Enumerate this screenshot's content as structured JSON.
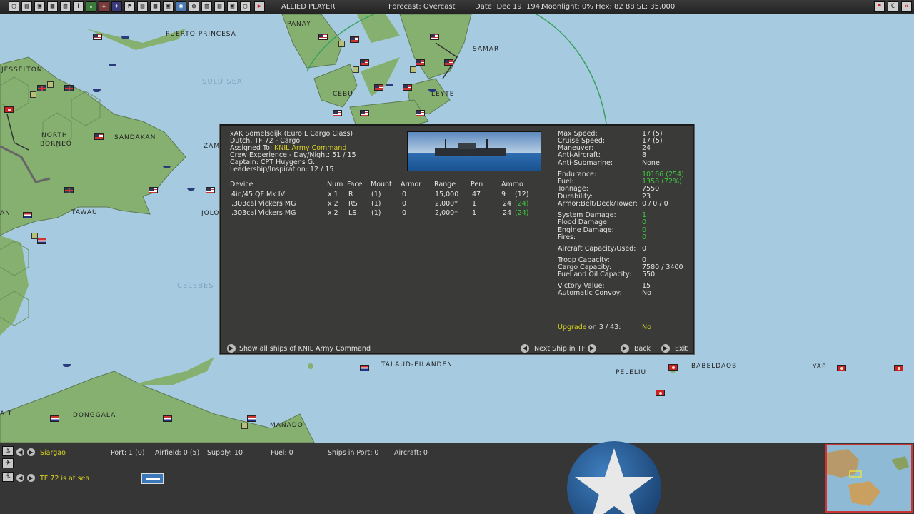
{
  "topbar": {
    "player": "ALLIED PLAYER",
    "forecast": "Forecast: Overcast",
    "date": "Date: Dec 19, 1941",
    "moonlight": "Moonlight: 0%",
    "hex": "Hex: 82 88  SL: 35,000",
    "icon_glyphs": [
      "▢",
      "▤",
      "▣",
      "▦",
      "▥",
      "Ⅰ",
      "★",
      "✚",
      "✈",
      "⚑",
      "▤",
      "▦",
      "▣",
      "◉",
      "◍",
      "▥",
      "▤",
      "▣",
      "▢",
      "▶"
    ],
    "right_icons": [
      "⚑",
      "C",
      "✕"
    ]
  },
  "map": {
    "labels": {
      "panay": "PANAY",
      "puerto_princesa": "PUERTO PRINCESA",
      "samar": "SAMAR",
      "jesselton": "JESSELTON",
      "sulu_sea": "SULU SEA",
      "cebu": "CEBU",
      "leyte": "LEYTE",
      "north_borneo_1": "NORTH",
      "north_borneo_2": "BORNEO",
      "sandakan": "SANDAKAN",
      "zam": "ZAM",
      "jolo": "JOLO",
      "tawau": "TAWAU",
      "an": "AN",
      "celebes": "CELEBES",
      "talaud": "TALAUD-EILANDEN",
      "babeldaob": "BABELDAOB",
      "yap": "YAP",
      "peleliu": "PELELIU",
      "donggala": "DONGGALA",
      "manado": "MANADO",
      "ait": "AIT"
    }
  },
  "dialog": {
    "ship_name": "xAK Somelsdijk (Euro L Cargo Class)",
    "nation_tf": "Dutch, TF 72 - Cargo",
    "assigned_label": "Assigned To:",
    "assigned_value": "KNIL Army Command",
    "crew": "Crew Experience - Day/Night: 51 / 15",
    "captain": "Captain: CPT Huygens G.",
    "leadership": "Leadership/Inspiration: 12 / 15",
    "weapons_headers": [
      "Device",
      "Num",
      "Face",
      "Mount",
      "Armor",
      "Range",
      "Pen",
      "Ammo"
    ],
    "weapons": [
      {
        "device": "4in/45 QF Mk IV",
        "num": "x 1",
        "face": "R",
        "mount": "(1)",
        "armor": "0",
        "range": "15,000",
        "pen": "47",
        "ammo": "9",
        "ammo_max": "(12)",
        "ammo_color": "white"
      },
      {
        "device": ".303cal Vickers MG",
        "num": "x 2",
        "face": "RS",
        "mount": "(1)",
        "armor": "0",
        "range": "2,000*",
        "pen": "1",
        "ammo": "24",
        "ammo_max": "(24)",
        "ammo_color": "green"
      },
      {
        "device": ".303cal Vickers MG",
        "num": "x 2",
        "face": "LS",
        "mount": "(1)",
        "armor": "0",
        "range": "2,000*",
        "pen": "1",
        "ammo": "24",
        "ammo_max": "(24)",
        "ammo_color": "green"
      }
    ],
    "stats": {
      "max_speed_l": "Max Speed:",
      "max_speed_v": "17 (5)",
      "cruise_speed_l": "Cruise Speed:",
      "cruise_speed_v": "17 (5)",
      "maneuver_l": "Maneuver:",
      "maneuver_v": "24",
      "anti_aircraft_l": "Anti-Aircraft:",
      "anti_aircraft_v": "8",
      "anti_sub_l": "Anti-Submarine:",
      "anti_sub_v": "None",
      "endurance_l": "Endurance:",
      "endurance_v": "10166 (254)",
      "fuel_l": "Fuel:",
      "fuel_v": "1358 (72%)",
      "tonnage_l": "Tonnage:",
      "tonnage_v": "7550",
      "durability_l": "Durability:",
      "durability_v": "23",
      "armor_l": "Armor:Belt/Deck/Tower:",
      "armor_v": "0 / 0 / 0",
      "sys_damage_l": "System Damage:",
      "sys_damage_v": "1",
      "flood_damage_l": "Flood Damage:",
      "flood_damage_v": "0",
      "engine_damage_l": "Engine Damage:",
      "engine_damage_v": "0",
      "fires_l": "Fires:",
      "fires_v": "0",
      "aircraft_cap_l": "Aircraft Capacity/Used:",
      "aircraft_cap_v": "0",
      "troop_cap_l": "Troop Capacity:",
      "troop_cap_v": "0",
      "cargo_cap_l": "Cargo Capacity:",
      "cargo_cap_v": "7580   / 3400",
      "fuel_oil_cap_l": "Fuel and Oil Capacity:",
      "fuel_oil_cap_v": "550",
      "victory_l": "Victory Value:",
      "victory_v": "15",
      "auto_convoy_l": "Automatic Convoy:",
      "auto_convoy_v": "No",
      "upgrade_l": "Upgrade",
      "upgrade_on": "on 3 / 43:",
      "upgrade_v": "No"
    },
    "footer": {
      "show_all": "Show all ships of KNIL Army Command",
      "next_ship": "Next Ship in TF",
      "back": "Back",
      "exit": "Exit"
    }
  },
  "bottom": {
    "base_name": "Siargao",
    "port": "Port: 1 (0)",
    "airfield": "Airfield: 0 (5)",
    "supply": "Supply: 10",
    "fuel": "Fuel: 0",
    "ships_in_port": "Ships in Port: 0",
    "aircraft": "Aircraft: 0",
    "tf_status": "TF 72 is at sea",
    "side_icons": [
      "⚓",
      "✈",
      "⚓"
    ]
  },
  "colors": {
    "highlight_yellow": "#d8d020",
    "value_green": "#40c840",
    "dialog_bg": "#3a3a38",
    "sea": "#a6cbe0",
    "land": "#86b070"
  }
}
